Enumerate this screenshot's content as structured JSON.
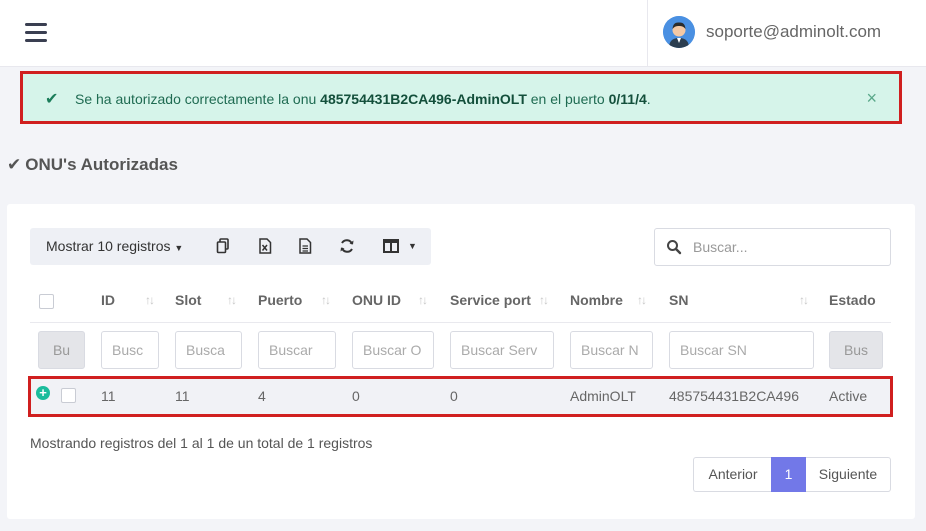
{
  "header": {
    "user_email": "soporte@adminolt.com"
  },
  "alert": {
    "prefix": "Se ha autorizado correctamente la onu ",
    "onu": "485754431B2CA496-AdminOLT",
    "middle": " en el puerto ",
    "port": "0/11/4",
    "suffix": ".",
    "close": "×"
  },
  "section": {
    "title": "ONU's Autorizadas"
  },
  "toolbar": {
    "show_label": "Mostrar 10 registros",
    "buttons": [
      "copy-icon",
      "excel-icon",
      "csv-icon",
      "refresh-icon",
      "columns-icon"
    ]
  },
  "search": {
    "placeholder": "Buscar..."
  },
  "table": {
    "columns": [
      "ID",
      "Slot",
      "Puerto",
      "ONU ID",
      "Service port",
      "Nombre",
      "SN",
      "Estado"
    ],
    "filters": {
      "first_button": "Bu",
      "id": "Busc",
      "slot": "Busca",
      "puerto": "Buscar",
      "onu_id": "Buscar O",
      "service_port": "Buscar Serv",
      "nombre": "Buscar N",
      "sn": "Buscar SN",
      "estado": "Bus"
    },
    "rows": [
      {
        "id": "11",
        "slot": "11",
        "puerto": "4",
        "onu_id": "0",
        "service_port": "0",
        "nombre": "AdminOLT",
        "sn": "485754431B2CA496",
        "estado": "Active"
      }
    ]
  },
  "footer": {
    "info": "Mostrando registros del 1 al 1 de un total de 1 registros",
    "prev": "Anterior",
    "page": "1",
    "next": "Siguiente"
  },
  "colors": {
    "accent": "#7278e8",
    "alert_bg": "#d6f4ea",
    "highlight_border": "#d01f1f",
    "plus_green": "#1abc9c"
  }
}
